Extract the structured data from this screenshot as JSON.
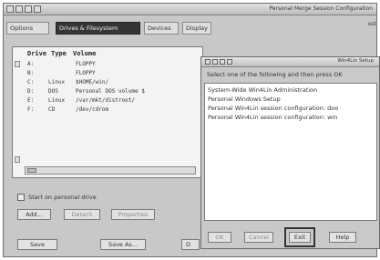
{
  "window": {
    "title": "Personal Merge Session Configuration"
  },
  "tabs": [
    {
      "label": "Options"
    },
    {
      "label": "Drives & Filesystem"
    },
    {
      "label": "Devices"
    },
    {
      "label": "Display"
    }
  ],
  "tab_overflow": "est",
  "drives": {
    "headers": {
      "drive": "Drive",
      "type": "Type",
      "volume": "Volume"
    },
    "rows": [
      {
        "drive": "A:",
        "type": "",
        "volume": "FLOPPY"
      },
      {
        "drive": "B:",
        "type": "",
        "volume": "FLOPPY"
      },
      {
        "drive": "C:",
        "type": "Linux",
        "volume": "$HOME/win/"
      },
      {
        "drive": "D:",
        "type": "DOS",
        "volume": "Personal DOS volume $"
      },
      {
        "drive": "E:",
        "type": "Linux",
        "volume": "/var/mkt/distroot/"
      },
      {
        "drive": "F:",
        "type": "CD",
        "volume": "/dev/cdrom"
      }
    ]
  },
  "options": {
    "start_drive_label": "Start on personal drive"
  },
  "drive_buttons": {
    "add": "Add...",
    "detach": "Detach",
    "properties": "Properties"
  },
  "bottom_buttons": {
    "save": "Save",
    "save_as": "Save As...",
    "third": "D"
  },
  "dialog": {
    "title": "Win4Lin Setup",
    "prompt": "Select one of the following and then press OK",
    "items": [
      "System-Wide Win4Lin Administration",
      "Personal Windows Setup",
      "Personal Win4Lin session configuration: doo",
      "Personal Win4Lin session configuration: win"
    ],
    "buttons": {
      "ok": "OK",
      "cancel": "Cancel",
      "exit": "Exit",
      "help": "Help"
    }
  },
  "colors": {
    "window_bg": "#c8c8c8",
    "active_tab": "#353535",
    "list_bg": "#ffffff"
  }
}
